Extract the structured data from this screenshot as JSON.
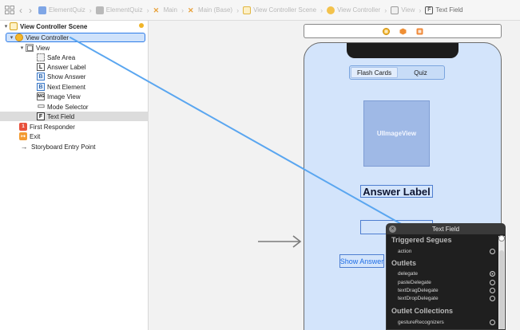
{
  "breadcrumb": [
    {
      "label": "ElementQuiz",
      "icon": "app-icon"
    },
    {
      "label": "ElementQuiz",
      "icon": "folder-icon"
    },
    {
      "label": "Main",
      "icon": "storyboard-icon"
    },
    {
      "label": "Main (Base)",
      "icon": "storyboard-icon"
    },
    {
      "label": "View Controller Scene",
      "icon": "scene-icon"
    },
    {
      "label": "View Controller",
      "icon": "view-controller-icon"
    },
    {
      "label": "View",
      "icon": "view-icon"
    },
    {
      "label": "Text Field",
      "icon": "text-field-icon"
    }
  ],
  "outline": {
    "scene": "View Controller Scene",
    "view_controller": "View Controller",
    "view": "View",
    "safe_area": "Safe Area",
    "answer_label": "Answer Label",
    "show_answer": "Show Answer",
    "next_element": "Next Element",
    "image_view": "Image View",
    "mode_selector": "Mode Selector",
    "text_field": "Text Field",
    "first_responder": "First Responder",
    "exit": "Exit",
    "entry_point": "Storyboard Entry Point",
    "icon_letters": {
      "label": "L",
      "button": "B",
      "text_field": "F",
      "image": "IMG",
      "first_responder": "1",
      "exit": "↦"
    }
  },
  "canvas": {
    "segment": [
      "Flash Cards",
      "Quiz"
    ],
    "image_view": "UIImageView",
    "answer_label": "Answer Label",
    "show_answer_button": "Show Answer"
  },
  "hud": {
    "title": "Text Field",
    "sections": {
      "triggered_segues": "Triggered Segues",
      "outlets": "Outlets",
      "outlet_collections": "Outlet Collections"
    },
    "rows": {
      "action": "action",
      "delegate": "delegate",
      "paste_delegate": "pasteDelegate",
      "text_drag_delegate": "textDragDelegate",
      "text_drop_delegate": "textDropDelegate",
      "gesture_recognizers": "gestureRecognizers"
    },
    "connected": "delegate"
  },
  "colors": {
    "selection": "#2e7ce8",
    "connection_line": "#5aa6f0",
    "canvas_view": "#d3e4fb",
    "hud_background": "#1f1f1f"
  }
}
